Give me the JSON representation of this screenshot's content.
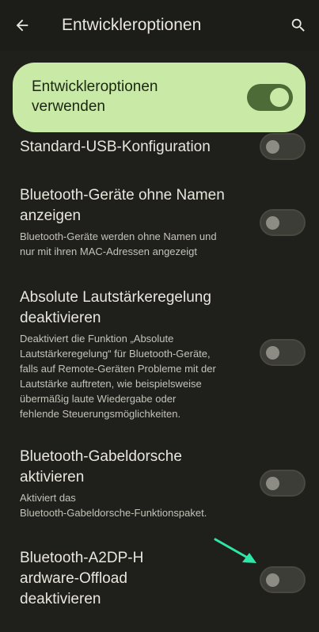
{
  "appbar": {
    "title": "Entwickleroptionen",
    "back_icon": "arrow-back-icon",
    "search_icon": "search-icon"
  },
  "master_switch": {
    "label_line1": "Entwickleroptionen",
    "label_line2": "verwenden",
    "state": "on"
  },
  "settings": [
    {
      "id": "usb",
      "title": "Standard-USB-Konfiguration",
      "state": "off"
    },
    {
      "id": "bt-no-names",
      "title_lines": [
        "Bluetooth-Geräte ohne Namen",
        "anzeigen"
      ],
      "summary_lines": [
        "Bluetooth-Geräte werden ohne Namen und",
        "nur mit ihren MAC-Adressen angezeigt"
      ],
      "state": "off"
    },
    {
      "id": "absolute-volume",
      "title_lines": [
        "Absolute Lautstärkeregelung",
        "deaktivieren"
      ],
      "summary_lines": [
        "Deaktiviert die Funktion „Absolute",
        "Lautstärkeregelung“ für Bluetooth-Geräte,",
        "falls auf Remote-Geräten Probleme mit der",
        "Lautstärke auftreten, wie beispielsweise",
        "übermäßig laute Wiedergabe oder",
        "fehlende Steuerungsmöglichkeiten."
      ],
      "state": "off"
    },
    {
      "id": "gabeldorsche",
      "title_lines": [
        "Bluetooth-Gabeldorsche",
        "aktivieren"
      ],
      "summary_lines": [
        "Aktiviert das",
        "Bluetooth-Gabeldorsche-Funktionspaket."
      ],
      "state": "off"
    },
    {
      "id": "a2dp-offload",
      "title_lines": [
        "Bluetooth-A2DP-H",
        "ardware-Offload",
        "deaktivieren"
      ],
      "state": "off"
    }
  ],
  "annotation": {
    "arrow_color": "#2ee6a8"
  },
  "colors": {
    "background": "#1f1f1b",
    "accent_card": "#c9e9a6",
    "toggle_on_track": "#4d6b37"
  }
}
